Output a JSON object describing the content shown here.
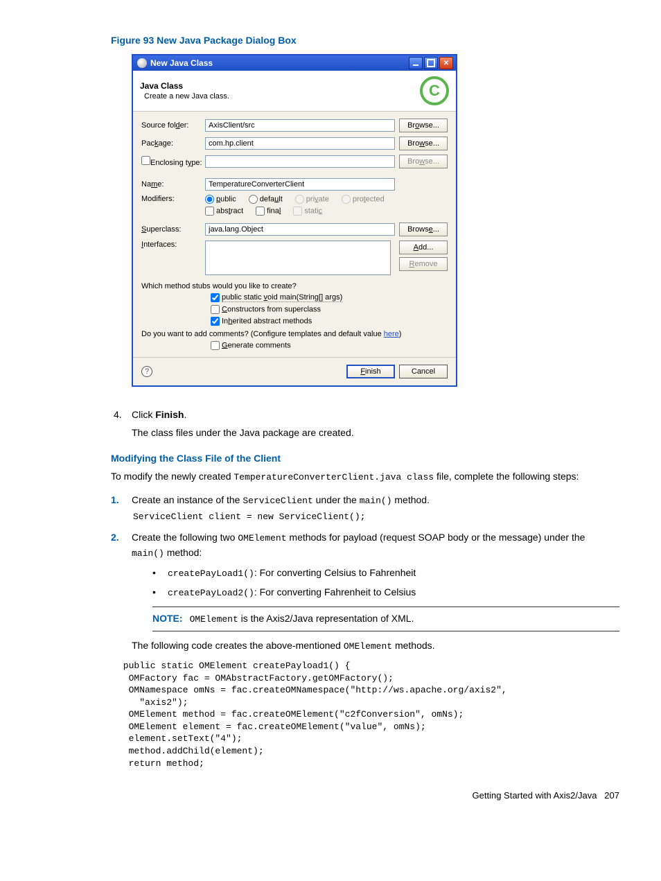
{
  "figure_caption": "Figure 93 New Java Package Dialog Box",
  "dialog": {
    "title": "New Java Class",
    "header_title": "Java Class",
    "header_desc": "Create a new Java class.",
    "labels": {
      "source_folder": "Source folder:",
      "package": "Package:",
      "enclosing_type": "Enclosing type:",
      "name": "Name:",
      "modifiers": "Modifiers:",
      "superclass": "Superclass:",
      "interfaces": "Interfaces:"
    },
    "values": {
      "source_folder": "AxisClient/src",
      "package": "com.hp.client",
      "enclosing_type": "",
      "name": "TemperatureConverterClient",
      "superclass": "java.lang.Object"
    },
    "buttons": {
      "browse": "Browse...",
      "add": "Add...",
      "remove": "Remove",
      "finish": "Finish",
      "cancel": "Cancel"
    },
    "modifiers": {
      "public": "public",
      "default": "default",
      "private": "private",
      "protected": "protected",
      "abstract": "abstract",
      "final": "final",
      "static": "static"
    },
    "stubs": {
      "question": "Which method stubs would you like to create?",
      "main": "public static void main(String[] args)",
      "constructors": "Constructors from superclass",
      "inherited": "Inherited abstract methods"
    },
    "comments": {
      "question_prefix": "Do you want to add comments? (Configure templates and default value ",
      "here": "here",
      "question_suffix": ")",
      "generate": "Generate comments"
    }
  },
  "doc": {
    "step4_num": "4.",
    "step4_text_prefix": "Click ",
    "step4_text_bold": "Finish",
    "step4_text_suffix": ".",
    "step4_followup": "The class files under the Java package are created.",
    "heading_modify": "Modifying the Class File of the Client",
    "para_modify_1": "To modify the newly created ",
    "para_modify_code": "TemperatureConverterClient.java class",
    "para_modify_2": " file, complete the following steps:",
    "sub1_num": "1.",
    "sub1_text_1": "Create an instance of the ",
    "sub1_code1": "ServiceClient",
    "sub1_text_2": " under the ",
    "sub1_code2": "main()",
    "sub1_text_3": " method.",
    "sub1_codeblock": "ServiceClient client = new ServiceClient();",
    "sub2_num": "2.",
    "sub2_text_1": "Create the following two ",
    "sub2_code1": "OMElement",
    "sub2_text_2": " methods for payload (request SOAP body or the message) under the ",
    "sub2_code2": "main()",
    "sub2_text_3": " method:",
    "bullet1_code": "createPayLoad1()",
    "bullet1_text": ": For converting Celsius to Fahrenheit",
    "bullet2_code": "createPayLoad2()",
    "bullet2_text": ": For converting Fahrenheit to Celsius",
    "note_label": "NOTE:",
    "note_code": "OMElement",
    "note_text": " is the Axis2/Java representation of XML.",
    "para_following_1": "The following code creates the above-mentioned ",
    "para_following_code": "OMElement",
    "para_following_2": " methods.",
    "bigcode": " public static OMElement createPayload1() {\n  OMFactory fac = OMAbstractFactory.getOMFactory();\n  OMNamespace omNs = fac.createOMNamespace(\"http://ws.apache.org/axis2\",\n    \"axis2\");\n  OMElement method = fac.createOMElement(\"c2fConversion\", omNs);\n  OMElement element = fac.createOMElement(\"value\", omNs);\n  element.setText(\"4\");\n  method.addChild(element);\n  return method;",
    "footer_text": "Getting Started with Axis2/Java",
    "footer_page": "207"
  }
}
